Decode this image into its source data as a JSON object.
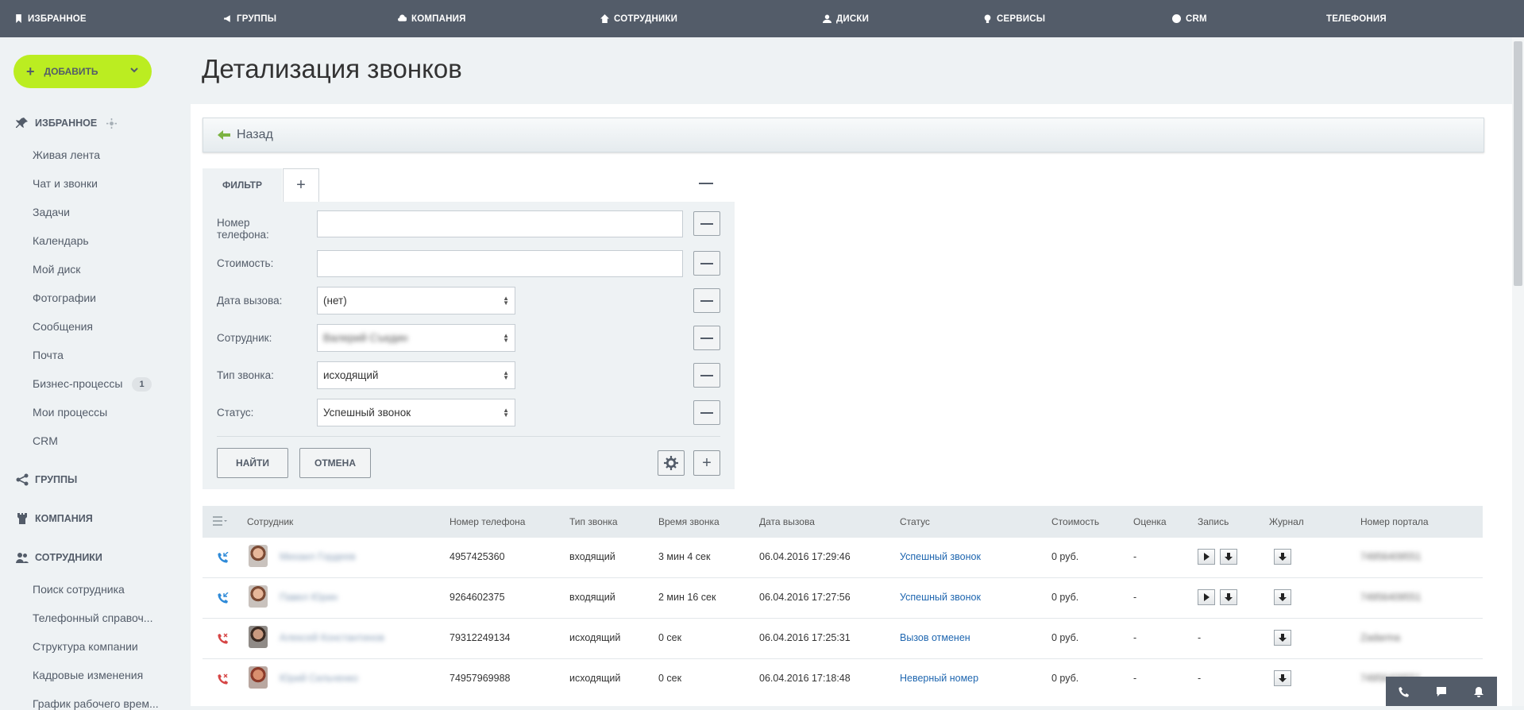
{
  "topnav": {
    "items": [
      {
        "label": "Избранное",
        "icon": "bookmark-icon"
      },
      {
        "label": "Группы",
        "icon": "megaphone-icon"
      },
      {
        "label": "Компания",
        "icon": "cloud-icon"
      },
      {
        "label": "Сотрудники",
        "icon": "home-icon"
      },
      {
        "label": "Диски",
        "icon": "user-icon"
      },
      {
        "label": "Сервисы",
        "icon": "bulb-icon"
      },
      {
        "label": "CRM",
        "icon": "crm-icon"
      },
      {
        "label": "Телефония",
        "icon": ""
      }
    ]
  },
  "sidebar": {
    "add_label": "Добавить",
    "favorites_title": "Избранное",
    "favorites_items": [
      {
        "label": "Живая лента"
      },
      {
        "label": "Чат и звонки"
      },
      {
        "label": "Задачи"
      },
      {
        "label": "Календарь"
      },
      {
        "label": "Мой диск"
      },
      {
        "label": "Фотографии"
      },
      {
        "label": "Сообщения"
      },
      {
        "label": "Почта"
      },
      {
        "label": "Бизнес-процессы",
        "badge": "1"
      },
      {
        "label": "Мои процессы"
      },
      {
        "label": "CRM"
      }
    ],
    "groups_title": "Группы",
    "company_title": "Компания",
    "employees_title": "Сотрудники",
    "employees_items": [
      {
        "label": "Поиск сотрудника"
      },
      {
        "label": "Телефонный справоч..."
      },
      {
        "label": "Структура компании"
      },
      {
        "label": "Кадровые изменения"
      },
      {
        "label": "График рабочего врем..."
      }
    ]
  },
  "page": {
    "title": "Детализация звонков",
    "back_label": "Назад"
  },
  "filter": {
    "tab_label": "ФИЛЬТР",
    "fields": {
      "phone_label": "Номер телефона:",
      "phone_value": "",
      "cost_label": "Стоимость:",
      "cost_value": "",
      "date_label": "Дата вызова:",
      "date_value": "(нет)",
      "employee_label": "Сотрудник:",
      "employee_value": "Валерий Съедин",
      "type_label": "Тип звонка:",
      "type_value": "исходящий",
      "status_label": "Статус:",
      "status_value": "Успешный звонок"
    },
    "find_label": "НАЙТИ",
    "cancel_label": "ОТМЕНА"
  },
  "table": {
    "columns": [
      "Сотрудник",
      "Номер телефона",
      "Тип звонка",
      "Время звонка",
      "Дата вызова",
      "Статус",
      "Стоимость",
      "Оценка",
      "Запись",
      "Журнал",
      "Номер портала"
    ],
    "rows": [
      {
        "employee": "Михаил Гордеев",
        "phone": "4957425360",
        "type": "входящий",
        "duration": "3 мин 4 сек",
        "date": "06.04.2016 17:29:46",
        "status": "Успешный звонок",
        "cost": "0 руб.",
        "rating": "-",
        "record": "",
        "portal": "74956409551",
        "call_dir": "incoming"
      },
      {
        "employee": "Павел Юрин",
        "phone": "9264602375",
        "type": "входящий",
        "duration": "2 мин 16 сек",
        "date": "06.04.2016 17:27:56",
        "status": "Успешный звонок",
        "cost": "0 руб.",
        "rating": "-",
        "record": "",
        "portal": "74956409551",
        "call_dir": "incoming"
      },
      {
        "employee": "Алексей Константинов",
        "phone": "79312249134",
        "type": "исходящий",
        "duration": "0 сек",
        "date": "06.04.2016 17:25:31",
        "status": "Вызов отменен",
        "cost": "0 руб.",
        "rating": "-",
        "record": "-",
        "portal": "Zadarma",
        "call_dir": "outgoing"
      },
      {
        "employee": "Юрий Сильченко",
        "phone": "74957969988",
        "type": "исходящий",
        "duration": "0 сек",
        "date": "06.04.2016 17:18:48",
        "status": "Неверный номер",
        "cost": "0 руб.",
        "rating": "-",
        "record": "-",
        "portal": "74956409551",
        "call_dir": "outgoing"
      }
    ]
  },
  "colors": {
    "topnav_bg": "#535c69",
    "add_button": "#bbed21",
    "link": "#2067b0",
    "incoming_icon": "#2e8ad8",
    "outgoing_icon": "#d64545"
  }
}
